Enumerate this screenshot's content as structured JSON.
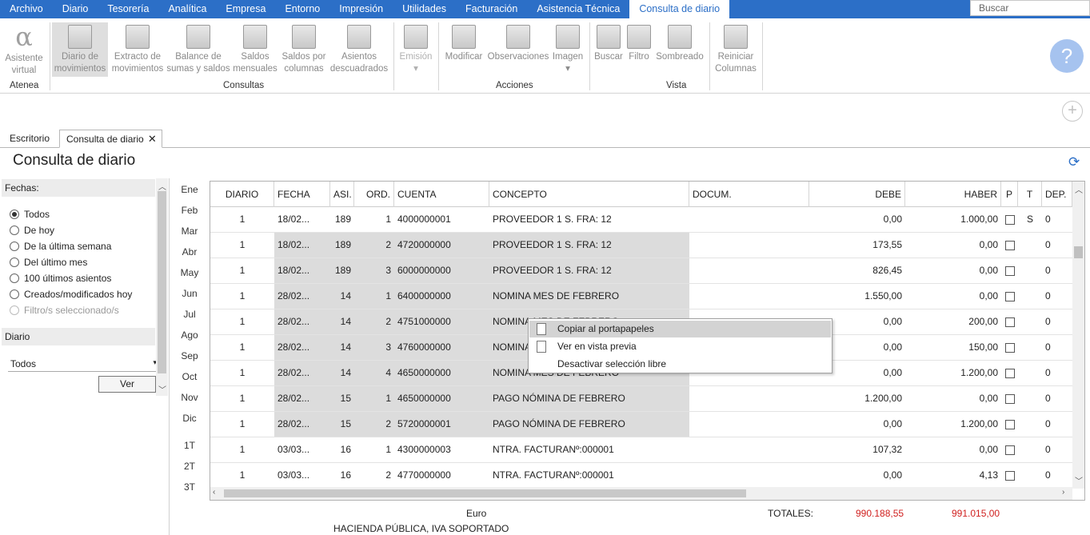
{
  "menu": {
    "tabs": [
      "Archivo",
      "Diario",
      "Tesorería",
      "Analítica",
      "Empresa",
      "Entorno",
      "Impresión",
      "Utilidades",
      "Facturación",
      "Asistencia Técnica",
      "Consulta de diario"
    ],
    "search_placeholder": "Buscar"
  },
  "ribbon": {
    "buttons": [
      {
        "label1": "Asistente",
        "label2": "virtual",
        "icon": "alpha-icon"
      },
      {
        "label1": "Diario de",
        "label2": "movimientos",
        "icon": "journal-icon"
      },
      {
        "label1": "Extracto de",
        "label2": "movimientos",
        "icon": "statement-icon"
      },
      {
        "label1": "Balance de",
        "label2": "sumas y saldos",
        "icon": "scale-icon"
      },
      {
        "label1": "Saldos",
        "label2": "mensuales",
        "icon": "monthly-balance-icon"
      },
      {
        "label1": "Saldos por",
        "label2": "columnas",
        "icon": "column-balance-icon"
      },
      {
        "label1": "Asientos",
        "label2": "descuadrados",
        "icon": "unbalanced-entries-icon"
      },
      {
        "label1": "Emisión",
        "label2": "▾",
        "icon": "print-icon"
      },
      {
        "label1": "Modificar",
        "label2": "",
        "icon": "edit-icon"
      },
      {
        "label1": "Observaciones",
        "label2": "",
        "icon": "notes-icon"
      },
      {
        "label1": "Imagen",
        "label2": "▾",
        "icon": "image-icon"
      },
      {
        "label1": "Buscar",
        "label2": "",
        "icon": "binoculars-icon"
      },
      {
        "label1": "Filtro",
        "label2": "",
        "icon": "filter-icon"
      },
      {
        "label1": "Sombreado",
        "label2": "",
        "icon": "shading-icon"
      },
      {
        "label1": "Reiniciar",
        "label2": "Columnas",
        "icon": "reset-columns-icon"
      }
    ],
    "groups": [
      "Atenea",
      "Consultas",
      "Acciones",
      "Vista"
    ]
  },
  "doc_tabs": [
    "Escritorio",
    "Consulta de diario"
  ],
  "page_title": "Consulta de diario",
  "filters": {
    "fechas_label": "Fechas:",
    "options": [
      "Todos",
      "De hoy",
      "De la última semana",
      "Del último mes",
      "100 últimos asientos",
      "Creados/modificados hoy",
      "Filtro/s seleccionado/s"
    ],
    "selected": "Todos",
    "diario_label": "Diario",
    "diario_value": "Todos",
    "ver_label": "Ver"
  },
  "months": [
    "Ene",
    "Feb",
    "Mar",
    "Abr",
    "May",
    "Jun",
    "Jul",
    "Ago",
    "Sep",
    "Oct",
    "Nov",
    "Dic",
    "1T",
    "2T",
    "3T"
  ],
  "grid": {
    "headers": [
      "DIARIO",
      "FECHA",
      "ASI.",
      "ORD.",
      "CUENTA",
      "CONCEPTO",
      "DOCUM.",
      "DEBE",
      "HABER",
      "P",
      "T",
      "DEP."
    ],
    "rows": [
      [
        "1",
        "18/02...",
        "189",
        "1",
        "4000000001",
        "PROVEEDOR 1 S. FRA:  12",
        "",
        "0,00",
        "1.000,00",
        "",
        "S",
        "0"
      ],
      [
        "1",
        "18/02...",
        "189",
        "2",
        "4720000000",
        "PROVEEDOR 1 S. FRA:  12",
        "",
        "173,55",
        "0,00",
        "",
        "",
        "0"
      ],
      [
        "1",
        "18/02...",
        "189",
        "3",
        "6000000000",
        "PROVEEDOR 1 S. FRA:  12",
        "",
        "826,45",
        "0,00",
        "",
        "",
        "0"
      ],
      [
        "1",
        "28/02...",
        "14",
        "1",
        "6400000000",
        "NOMINA MES DE  FEBRERO",
        "",
        "1.550,00",
        "0,00",
        "",
        "",
        "0"
      ],
      [
        "1",
        "28/02...",
        "14",
        "2",
        "4751000000",
        "NOMINA MES DE  FEBRERO",
        "",
        "0,00",
        "200,00",
        "",
        "",
        "0"
      ],
      [
        "1",
        "28/02...",
        "14",
        "3",
        "4760000000",
        "NOMINA MES DE  FEBRERO",
        "",
        "0,00",
        "150,00",
        "",
        "",
        "0"
      ],
      [
        "1",
        "28/02...",
        "14",
        "4",
        "4650000000",
        "NOMINA MES DE  FEBRERO",
        "",
        "0,00",
        "1.200,00",
        "",
        "",
        "0"
      ],
      [
        "1",
        "28/02...",
        "15",
        "1",
        "4650000000",
        "PAGO NÓMINA DE FEBRERO",
        "",
        "1.200,00",
        "0,00",
        "",
        "",
        "0"
      ],
      [
        "1",
        "28/02...",
        "15",
        "2",
        "5720000001",
        "PAGO NÓMINA DE FEBRERO",
        "",
        "0,00",
        "1.200,00",
        "",
        "",
        "0"
      ],
      [
        "1",
        "03/03...",
        "16",
        "1",
        "4300000003",
        "NTRA. FACTURANº:000001",
        "",
        "107,32",
        "0,00",
        "",
        "",
        "0"
      ],
      [
        "1",
        "03/03...",
        "16",
        "2",
        "4770000000",
        "NTRA. FACTURANº:000001",
        "",
        "0,00",
        "4,13",
        "",
        "",
        "0"
      ]
    ]
  },
  "context_menu": [
    "Copiar al portapapeles",
    "Ver en vista previa",
    "Desactivar selección libre"
  ],
  "footer": {
    "currency": "Euro",
    "account_name": "HACIENDA PÚBLICA, IVA SOPORTADO",
    "totals_label": "TOTALES:",
    "total_debe": "990.188,55",
    "total_haber": "991.015,00"
  }
}
